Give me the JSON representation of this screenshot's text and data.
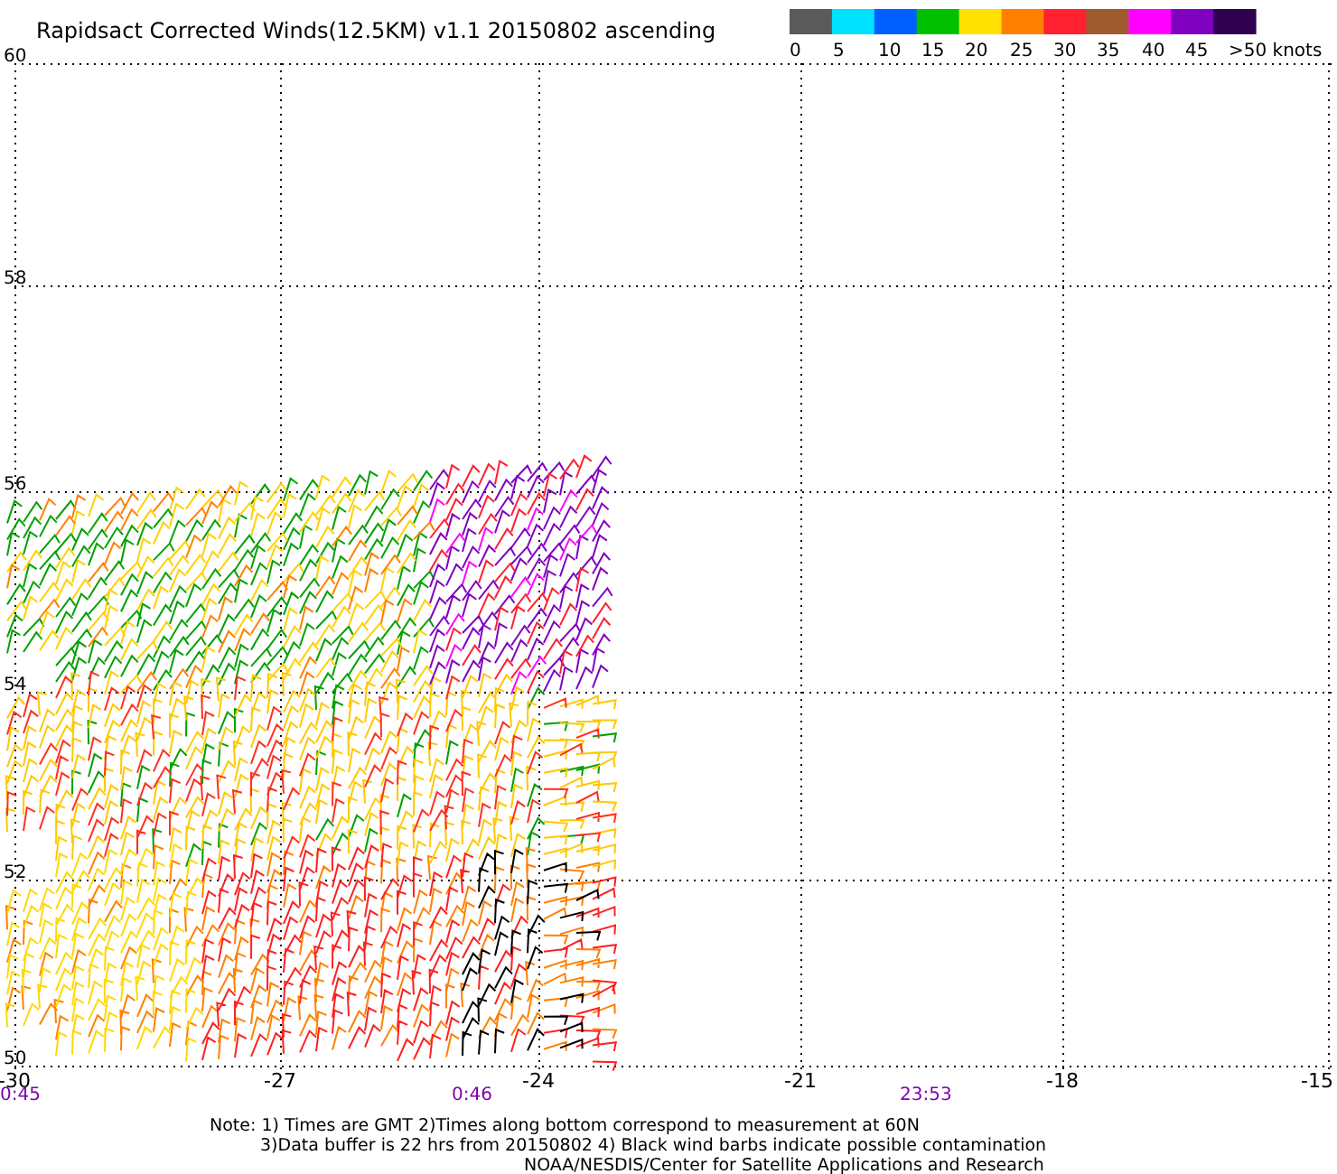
{
  "title": "Rapidsact Corrected Winds(12.5KM) v1.1 20150802 ascending",
  "legend": {
    "bins": [
      {
        "color": "#5a5a5a"
      },
      {
        "color": "#00e0ff"
      },
      {
        "color": "#0060ff"
      },
      {
        "color": "#00c000"
      },
      {
        "color": "#ffe000"
      },
      {
        "color": "#ff8000"
      },
      {
        "color": "#ff2030"
      },
      {
        "color": "#a05a30"
      },
      {
        "color": "#ff00ff"
      },
      {
        "color": "#8000c0"
      },
      {
        "color": "#300050"
      }
    ],
    "labels": [
      "0",
      "5",
      "10",
      "15",
      "20",
      "25",
      "30",
      "35",
      "40",
      "45",
      ">50 knots"
    ]
  },
  "latitude_labels": [
    "60",
    "58",
    "56",
    "54",
    "52",
    "50"
  ],
  "longitude_labels": [
    "-30",
    "-27",
    "-24",
    "-21",
    "-18",
    "-15"
  ],
  "time_labels": [
    "0:45",
    "0:46",
    "23:53"
  ],
  "notes": [
    "Note: 1) Times are GMT 2)Times along bottom correspond to measurement at 60N",
    "3)Data buffer is 22 hrs from 20150802 4) Black wind barbs indicate possible contamination",
    "NOAA/NESDIS/Center for Satellite Applications and Research"
  ]
}
